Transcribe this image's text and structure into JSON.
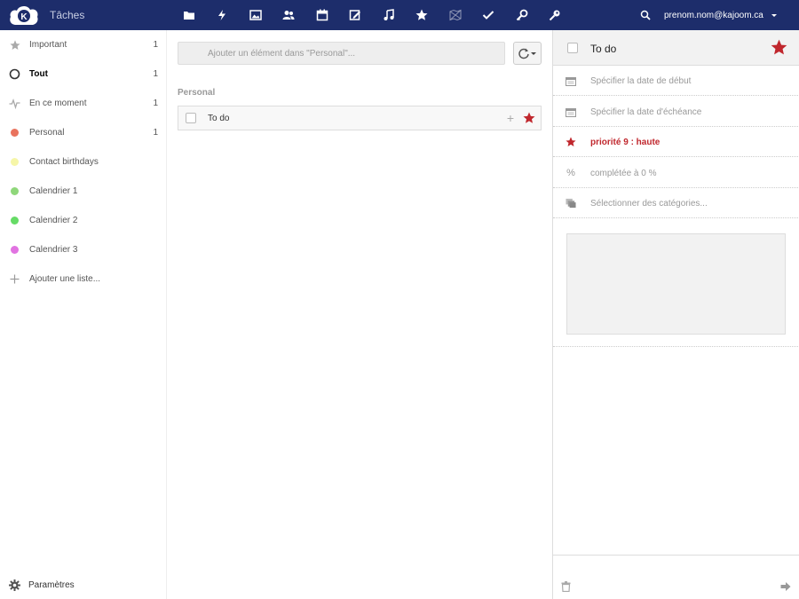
{
  "header": {
    "app_name": "Tâches",
    "nav_icons": [
      "files-icon",
      "activity-icon",
      "gallery-icon",
      "contacts-icon",
      "calendar-icon",
      "notes-icon",
      "music-icon",
      "bookmarks-icon",
      "map-icon",
      "tasks-icon",
      "passwords-icon",
      "keys-icon"
    ],
    "user": "prenom.nom@kajoom.ca",
    "colors": {
      "bar": "#1d2d6b"
    }
  },
  "sidebar": {
    "items": [
      {
        "label": "Important",
        "count": "1",
        "icon": "star-icon"
      },
      {
        "label": "Tout",
        "count": "1",
        "icon": "circle-icon"
      },
      {
        "label": "En ce moment",
        "count": "1",
        "icon": "pulse-icon"
      },
      {
        "label": "Personal",
        "count": "1",
        "color": "#e9735e"
      },
      {
        "label": "Contact birthdays",
        "count": "",
        "color": "#f6f6a8"
      },
      {
        "label": "Calendrier 1",
        "count": "",
        "color": "#8fd77a"
      },
      {
        "label": "Calendrier 2",
        "count": "",
        "color": "#66db66"
      },
      {
        "label": "Calendrier 3",
        "count": "",
        "color": "#e173e1"
      },
      {
        "label": "Ajouter une liste...",
        "count": "",
        "icon": "plus-icon"
      }
    ],
    "settings_label": "Paramètres"
  },
  "main": {
    "add_placeholder": "Ajouter un élément dans \"Personal\"...",
    "list_heading": "Personal",
    "tasks": [
      {
        "label": "To do",
        "starred": true
      }
    ]
  },
  "details": {
    "title": "To do",
    "rows": {
      "start_date": "Spécifier la date de début",
      "due_date": "Spécifier la date d'échéance",
      "priority": "priorité 9 : haute",
      "percent_icon": "%",
      "completion": "complétée à 0 %",
      "categories": "Sélectionner des catégories..."
    },
    "colors": {
      "star": "#c0272d"
    }
  }
}
